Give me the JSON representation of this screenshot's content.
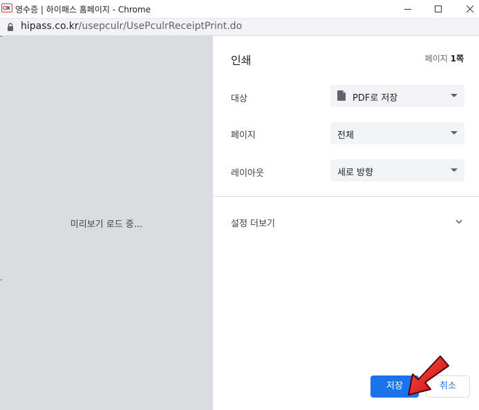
{
  "window": {
    "title": "영수증 | 하이패스 홈페이지 - Chrome",
    "favicon": "ex-favicon-icon"
  },
  "address": {
    "host": "hipass.co.kr",
    "path": "/usepculr/UsePculrReceiptPrint.do"
  },
  "preview": {
    "loading_text": "미리보기 로드 중..."
  },
  "print": {
    "title": "인쇄",
    "page_count_prefix": "페이지 ",
    "page_count_value": "1쪽",
    "rows": [
      {
        "label": "대상",
        "value": "PDF로 저장",
        "icon": "document-icon"
      },
      {
        "label": "페이지",
        "value": "전체"
      },
      {
        "label": "레이아웃",
        "value": "세로 방향"
      }
    ],
    "more_settings": "설정 더보기",
    "save_button": "저장",
    "cancel_button": "취소"
  },
  "colors": {
    "accent": "#1a73e8",
    "preview_bg": "#dadce0",
    "annotation_arrow": "#e8141b"
  }
}
